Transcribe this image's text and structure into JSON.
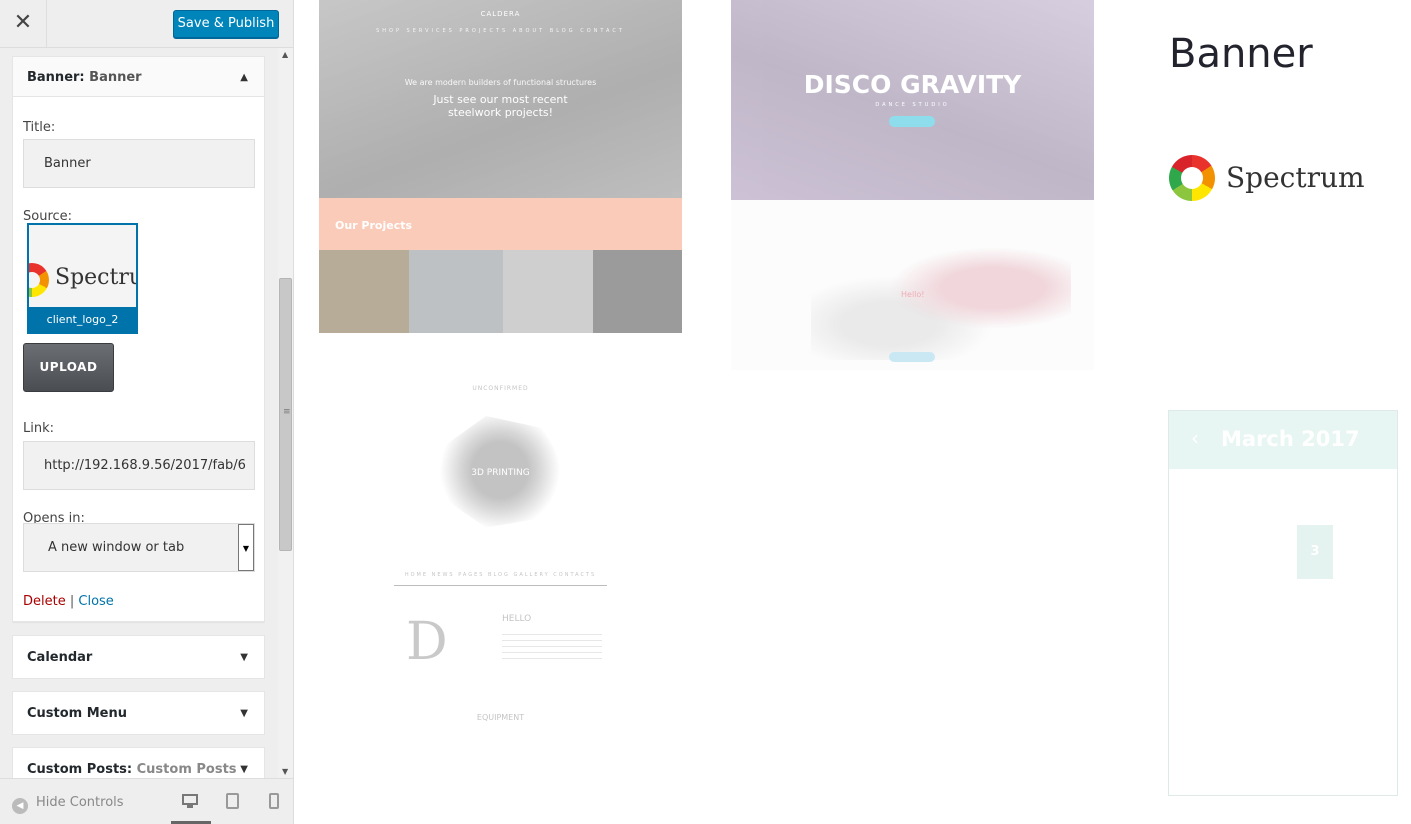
{
  "topbar": {
    "close_glyph": "✕",
    "save_label": "Save & Publish"
  },
  "widget": {
    "type_label": "Banner:",
    "name_label": "Banner",
    "collapse_glyph": "▲",
    "title_label": "Title:",
    "title_value": "Banner",
    "source_label": "Source:",
    "thumb_logo_text": "Spectrum",
    "thumb_caption": "client_logo_2",
    "upload_label": "UPLOAD",
    "link_label": "Link:",
    "link_value": "http://192.168.9.56/2017/fab/6",
    "opens_label": "Opens in:",
    "opens_value": "A new window or tab",
    "select_caret": "▼",
    "delete_label": "Delete",
    "separator": "|",
    "close_label": "Close"
  },
  "sections": [
    {
      "title": "Calendar",
      "sub": "",
      "arrow": "▼"
    },
    {
      "title": "Custom Menu",
      "sub": "",
      "arrow": "▼"
    },
    {
      "title": "Custom Posts:",
      "sub": "Custom Posts",
      "arrow": "▼"
    }
  ],
  "scrollbar": {
    "up": "▲",
    "down": "▼",
    "grip": "≡"
  },
  "footer": {
    "hide_label": "Hide Controls",
    "hide_glyph": "◀"
  },
  "preview": {
    "caldera": {
      "brand": "CALDERA",
      "nav": "SHOP  SERVICES  PROJECTS  ABOUT  BLOG  CONTACT",
      "tagline": "We are modern builders of functional structures",
      "headline_1": "Just see our most recent",
      "headline_2": "steelwork projects!",
      "section_title": "Our Projects"
    },
    "disco": {
      "title": "DISCO GRAVITY",
      "subtitle": "DANCE STUDIO"
    },
    "dance": {
      "hello": "Hello!"
    },
    "printing": {
      "top": "UNCONFIRMED",
      "label": "3D PRINTING",
      "menu": "HOME  NEWS  PAGES  BLOG  GALLERY  CONTACTS",
      "big_letter": "D",
      "hello": "HELLO",
      "equipment": "EQUIPMENT"
    },
    "banner_title": "Banner",
    "spectrum_text": "Spectrum",
    "calendar": {
      "prev_glyph": "‹",
      "month": "March 2017",
      "today": "3"
    }
  },
  "colors": {
    "primary_button": "#0085ba",
    "selected_border": "#0073aa",
    "delete_link": "#aa0000",
    "close_link": "#0073aa"
  }
}
